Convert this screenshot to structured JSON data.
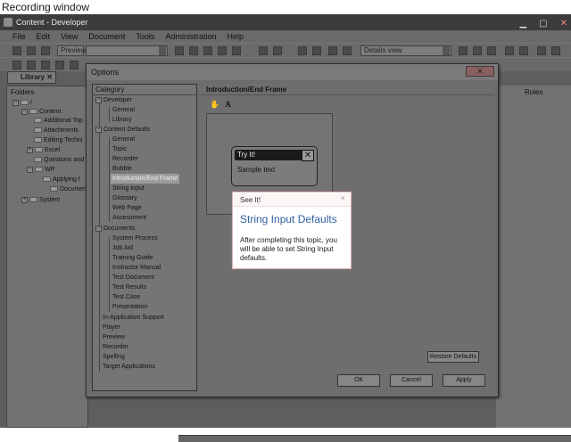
{
  "recording_window": {
    "title": "Recording window"
  },
  "app": {
    "title": "Content - Developer",
    "menu": [
      "File",
      "Edit",
      "View",
      "Document",
      "Tools",
      "Administration",
      "Help"
    ],
    "preview_label": "Preview",
    "view_combo": "Details view",
    "library_tab": "Library",
    "folders_header": "Folders",
    "roles_header": "Roles",
    "tree": [
      {
        "label": "Content"
      },
      {
        "label": "Additional Top"
      },
      {
        "label": "Attachments"
      },
      {
        "label": "Editing Techni"
      },
      {
        "label": "Excel"
      },
      {
        "label": "Questions and"
      },
      {
        "label": "WP"
      },
      {
        "label": "Applying f"
      },
      {
        "label": "Documen"
      },
      {
        "label": "System"
      }
    ]
  },
  "dialog": {
    "title": "Options",
    "category_header": "Category",
    "categories": {
      "developer": "Developer",
      "dev_general": "General",
      "dev_library": "Library",
      "content_defaults": "Content Defaults",
      "cd_general": "General",
      "cd_topic": "Topic",
      "cd_recorder": "Recorder",
      "cd_bubble": "Bubble",
      "cd_intro": "Introduction/End Frame",
      "cd_string": "String Input",
      "cd_glossary": "Glossary",
      "cd_web": "Web Page",
      "cd_assess": "Assessment",
      "documents": "Documents",
      "doc_system": "System Process",
      "doc_jobaid": "Job Aid",
      "doc_training": "Training Guide",
      "doc_instructor": "Instructor Manual",
      "doc_testdoc": "Test Document",
      "doc_testres": "Test Results",
      "doc_testcase": "Test Case",
      "doc_present": "Presentation",
      "in_app": "In-Application Support",
      "player": "Player",
      "preview": "Preview",
      "recorder": "Recorder",
      "spelling": "Spelling",
      "target_apps": "Target Applications"
    },
    "content_title": "Introduction/End Frame",
    "font_icon_a": "A",
    "tryit_title": "Try It!",
    "tryit_close": "✕",
    "tryit_text": "Sample text",
    "restore_defaults": "Restore Defaults",
    "ok": "OK",
    "cancel": "Cancel",
    "apply": "Apply"
  },
  "bubble": {
    "header": "See It!",
    "close": "×",
    "title": "String Input Defaults",
    "body": "After completing this topic, you will be able to set String Input defaults."
  }
}
